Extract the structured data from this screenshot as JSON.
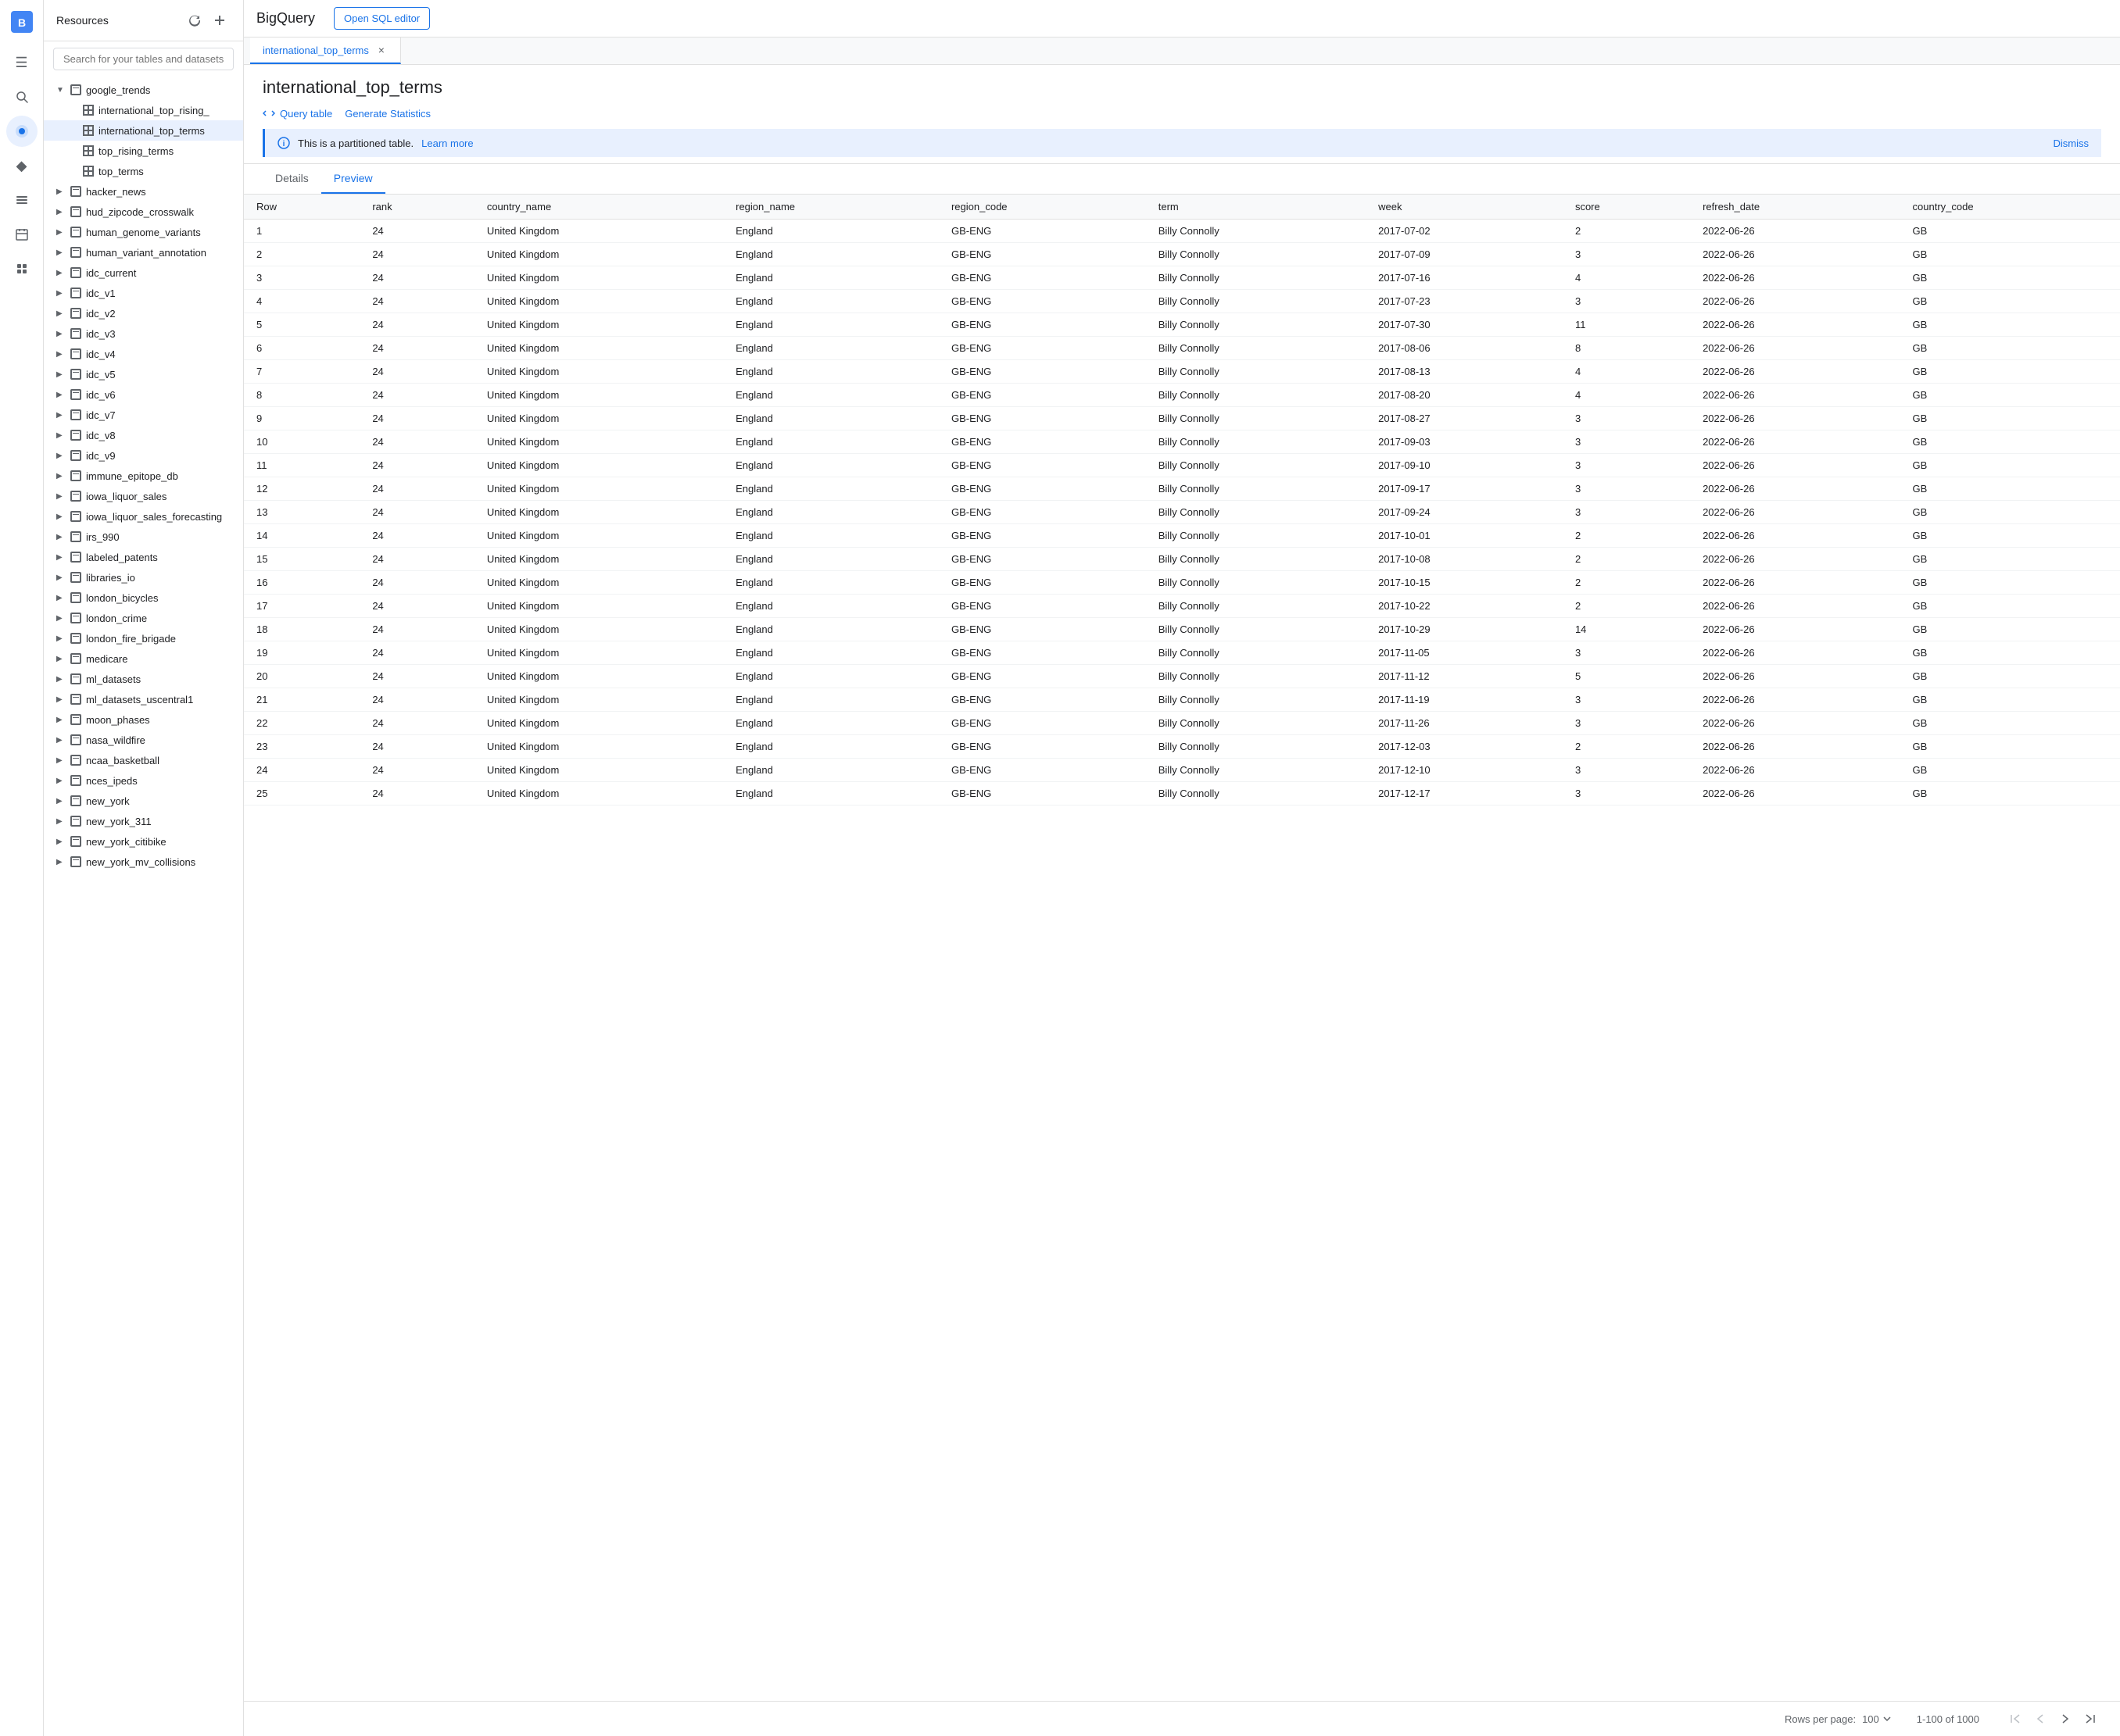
{
  "app": {
    "title": "BigQuery",
    "open_sql_label": "Open SQL editor"
  },
  "tab": {
    "name": "international_top_terms",
    "close_label": "×"
  },
  "page": {
    "title": "international_top_terms",
    "query_table_label": "Query table",
    "gen_stats_label": "Generate Statistics",
    "info_message": "This is a partitioned table.",
    "learn_more_label": "Learn more",
    "dismiss_label": "Dismiss"
  },
  "inner_tabs": [
    {
      "label": "Details",
      "active": false
    },
    {
      "label": "Preview",
      "active": true
    }
  ],
  "sidebar": {
    "title": "Resources",
    "search_placeholder": "Search for your tables and datasets",
    "tree": [
      {
        "label": "google_trends",
        "level": 1,
        "type": "dataset",
        "expanded": true
      },
      {
        "label": "international_top_rising_",
        "level": 2,
        "type": "table"
      },
      {
        "label": "international_top_terms",
        "level": 2,
        "type": "table",
        "active": true
      },
      {
        "label": "top_rising_terms",
        "level": 2,
        "type": "table"
      },
      {
        "label": "top_terms",
        "level": 2,
        "type": "table"
      },
      {
        "label": "hacker_news",
        "level": 1,
        "type": "dataset"
      },
      {
        "label": "hud_zipcode_crosswalk",
        "level": 1,
        "type": "dataset"
      },
      {
        "label": "human_genome_variants",
        "level": 1,
        "type": "dataset"
      },
      {
        "label": "human_variant_annotation",
        "level": 1,
        "type": "dataset"
      },
      {
        "label": "idc_current",
        "level": 1,
        "type": "dataset"
      },
      {
        "label": "idc_v1",
        "level": 1,
        "type": "dataset"
      },
      {
        "label": "idc_v2",
        "level": 1,
        "type": "dataset"
      },
      {
        "label": "idc_v3",
        "level": 1,
        "type": "dataset"
      },
      {
        "label": "idc_v4",
        "level": 1,
        "type": "dataset"
      },
      {
        "label": "idc_v5",
        "level": 1,
        "type": "dataset"
      },
      {
        "label": "idc_v6",
        "level": 1,
        "type": "dataset"
      },
      {
        "label": "idc_v7",
        "level": 1,
        "type": "dataset"
      },
      {
        "label": "idc_v8",
        "level": 1,
        "type": "dataset"
      },
      {
        "label": "idc_v9",
        "level": 1,
        "type": "dataset"
      },
      {
        "label": "immune_epitope_db",
        "level": 1,
        "type": "dataset"
      },
      {
        "label": "iowa_liquor_sales",
        "level": 1,
        "type": "dataset"
      },
      {
        "label": "iowa_liquor_sales_forecasting",
        "level": 1,
        "type": "dataset"
      },
      {
        "label": "irs_990",
        "level": 1,
        "type": "dataset"
      },
      {
        "label": "labeled_patents",
        "level": 1,
        "type": "dataset"
      },
      {
        "label": "libraries_io",
        "level": 1,
        "type": "dataset"
      },
      {
        "label": "london_bicycles",
        "level": 1,
        "type": "dataset"
      },
      {
        "label": "london_crime",
        "level": 1,
        "type": "dataset"
      },
      {
        "label": "london_fire_brigade",
        "level": 1,
        "type": "dataset"
      },
      {
        "label": "medicare",
        "level": 1,
        "type": "dataset"
      },
      {
        "label": "ml_datasets",
        "level": 1,
        "type": "dataset"
      },
      {
        "label": "ml_datasets_uscentral1",
        "level": 1,
        "type": "dataset"
      },
      {
        "label": "moon_phases",
        "level": 1,
        "type": "dataset"
      },
      {
        "label": "nasa_wildfire",
        "level": 1,
        "type": "dataset"
      },
      {
        "label": "ncaa_basketball",
        "level": 1,
        "type": "dataset"
      },
      {
        "label": "nces_ipeds",
        "level": 1,
        "type": "dataset"
      },
      {
        "label": "new_york",
        "level": 1,
        "type": "dataset"
      },
      {
        "label": "new_york_311",
        "level": 1,
        "type": "dataset"
      },
      {
        "label": "new_york_citibike",
        "level": 1,
        "type": "dataset"
      },
      {
        "label": "new_york_mv_collisions",
        "level": 1,
        "type": "dataset"
      }
    ]
  },
  "table": {
    "columns": [
      "Row",
      "rank",
      "country_name",
      "region_name",
      "region_code",
      "term",
      "week",
      "score",
      "refresh_date",
      "country_code"
    ],
    "rows": [
      [
        1,
        24,
        "United Kingdom",
        "England",
        "GB-ENG",
        "Billy Connolly",
        "2017-07-02",
        2,
        "2022-06-26",
        "GB"
      ],
      [
        2,
        24,
        "United Kingdom",
        "England",
        "GB-ENG",
        "Billy Connolly",
        "2017-07-09",
        3,
        "2022-06-26",
        "GB"
      ],
      [
        3,
        24,
        "United Kingdom",
        "England",
        "GB-ENG",
        "Billy Connolly",
        "2017-07-16",
        4,
        "2022-06-26",
        "GB"
      ],
      [
        4,
        24,
        "United Kingdom",
        "England",
        "GB-ENG",
        "Billy Connolly",
        "2017-07-23",
        3,
        "2022-06-26",
        "GB"
      ],
      [
        5,
        24,
        "United Kingdom",
        "England",
        "GB-ENG",
        "Billy Connolly",
        "2017-07-30",
        11,
        "2022-06-26",
        "GB"
      ],
      [
        6,
        24,
        "United Kingdom",
        "England",
        "GB-ENG",
        "Billy Connolly",
        "2017-08-06",
        8,
        "2022-06-26",
        "GB"
      ],
      [
        7,
        24,
        "United Kingdom",
        "England",
        "GB-ENG",
        "Billy Connolly",
        "2017-08-13",
        4,
        "2022-06-26",
        "GB"
      ],
      [
        8,
        24,
        "United Kingdom",
        "England",
        "GB-ENG",
        "Billy Connolly",
        "2017-08-20",
        4,
        "2022-06-26",
        "GB"
      ],
      [
        9,
        24,
        "United Kingdom",
        "England",
        "GB-ENG",
        "Billy Connolly",
        "2017-08-27",
        3,
        "2022-06-26",
        "GB"
      ],
      [
        10,
        24,
        "United Kingdom",
        "England",
        "GB-ENG",
        "Billy Connolly",
        "2017-09-03",
        3,
        "2022-06-26",
        "GB"
      ],
      [
        11,
        24,
        "United Kingdom",
        "England",
        "GB-ENG",
        "Billy Connolly",
        "2017-09-10",
        3,
        "2022-06-26",
        "GB"
      ],
      [
        12,
        24,
        "United Kingdom",
        "England",
        "GB-ENG",
        "Billy Connolly",
        "2017-09-17",
        3,
        "2022-06-26",
        "GB"
      ],
      [
        13,
        24,
        "United Kingdom",
        "England",
        "GB-ENG",
        "Billy Connolly",
        "2017-09-24",
        3,
        "2022-06-26",
        "GB"
      ],
      [
        14,
        24,
        "United Kingdom",
        "England",
        "GB-ENG",
        "Billy Connolly",
        "2017-10-01",
        2,
        "2022-06-26",
        "GB"
      ],
      [
        15,
        24,
        "United Kingdom",
        "England",
        "GB-ENG",
        "Billy Connolly",
        "2017-10-08",
        2,
        "2022-06-26",
        "GB"
      ],
      [
        16,
        24,
        "United Kingdom",
        "England",
        "GB-ENG",
        "Billy Connolly",
        "2017-10-15",
        2,
        "2022-06-26",
        "GB"
      ],
      [
        17,
        24,
        "United Kingdom",
        "England",
        "GB-ENG",
        "Billy Connolly",
        "2017-10-22",
        2,
        "2022-06-26",
        "GB"
      ],
      [
        18,
        24,
        "United Kingdom",
        "England",
        "GB-ENG",
        "Billy Connolly",
        "2017-10-29",
        14,
        "2022-06-26",
        "GB"
      ],
      [
        19,
        24,
        "United Kingdom",
        "England",
        "GB-ENG",
        "Billy Connolly",
        "2017-11-05",
        3,
        "2022-06-26",
        "GB"
      ],
      [
        20,
        24,
        "United Kingdom",
        "England",
        "GB-ENG",
        "Billy Connolly",
        "2017-11-12",
        5,
        "2022-06-26",
        "GB"
      ],
      [
        21,
        24,
        "United Kingdom",
        "England",
        "GB-ENG",
        "Billy Connolly",
        "2017-11-19",
        3,
        "2022-06-26",
        "GB"
      ],
      [
        22,
        24,
        "United Kingdom",
        "England",
        "GB-ENG",
        "Billy Connolly",
        "2017-11-26",
        3,
        "2022-06-26",
        "GB"
      ],
      [
        23,
        24,
        "United Kingdom",
        "England",
        "GB-ENG",
        "Billy Connolly",
        "2017-12-03",
        2,
        "2022-06-26",
        "GB"
      ],
      [
        24,
        24,
        "United Kingdom",
        "England",
        "GB-ENG",
        "Billy Connolly",
        "2017-12-10",
        3,
        "2022-06-26",
        "GB"
      ],
      [
        25,
        24,
        "United Kingdom",
        "England",
        "GB-ENG",
        "Billy Connolly",
        "2017-12-17",
        3,
        "2022-06-26",
        "GB"
      ]
    ]
  },
  "footer": {
    "rows_per_page_label": "Rows per page:",
    "rows_per_page_value": "100",
    "pagination_info": "1-100 of 1000"
  },
  "nav_icons": [
    "☰",
    "🔍",
    "●",
    "◆",
    "☰",
    "📅",
    "🔌"
  ]
}
